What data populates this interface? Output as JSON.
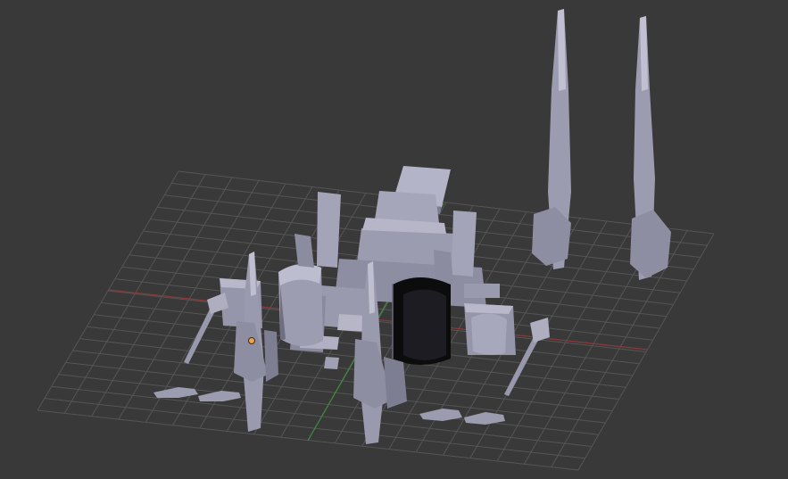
{
  "viewport": {
    "background": "#393939",
    "grid_color": "#555555",
    "x_axis_color": "#8a3a3a",
    "y_axis_color": "#3f8a3f",
    "model_color": "#9a9ab0",
    "model_shadow": "#6d6d80",
    "model_highlight": "#c2c2d4",
    "selected_color": "#0c0c0c",
    "origin_color": "#f0a050"
  }
}
